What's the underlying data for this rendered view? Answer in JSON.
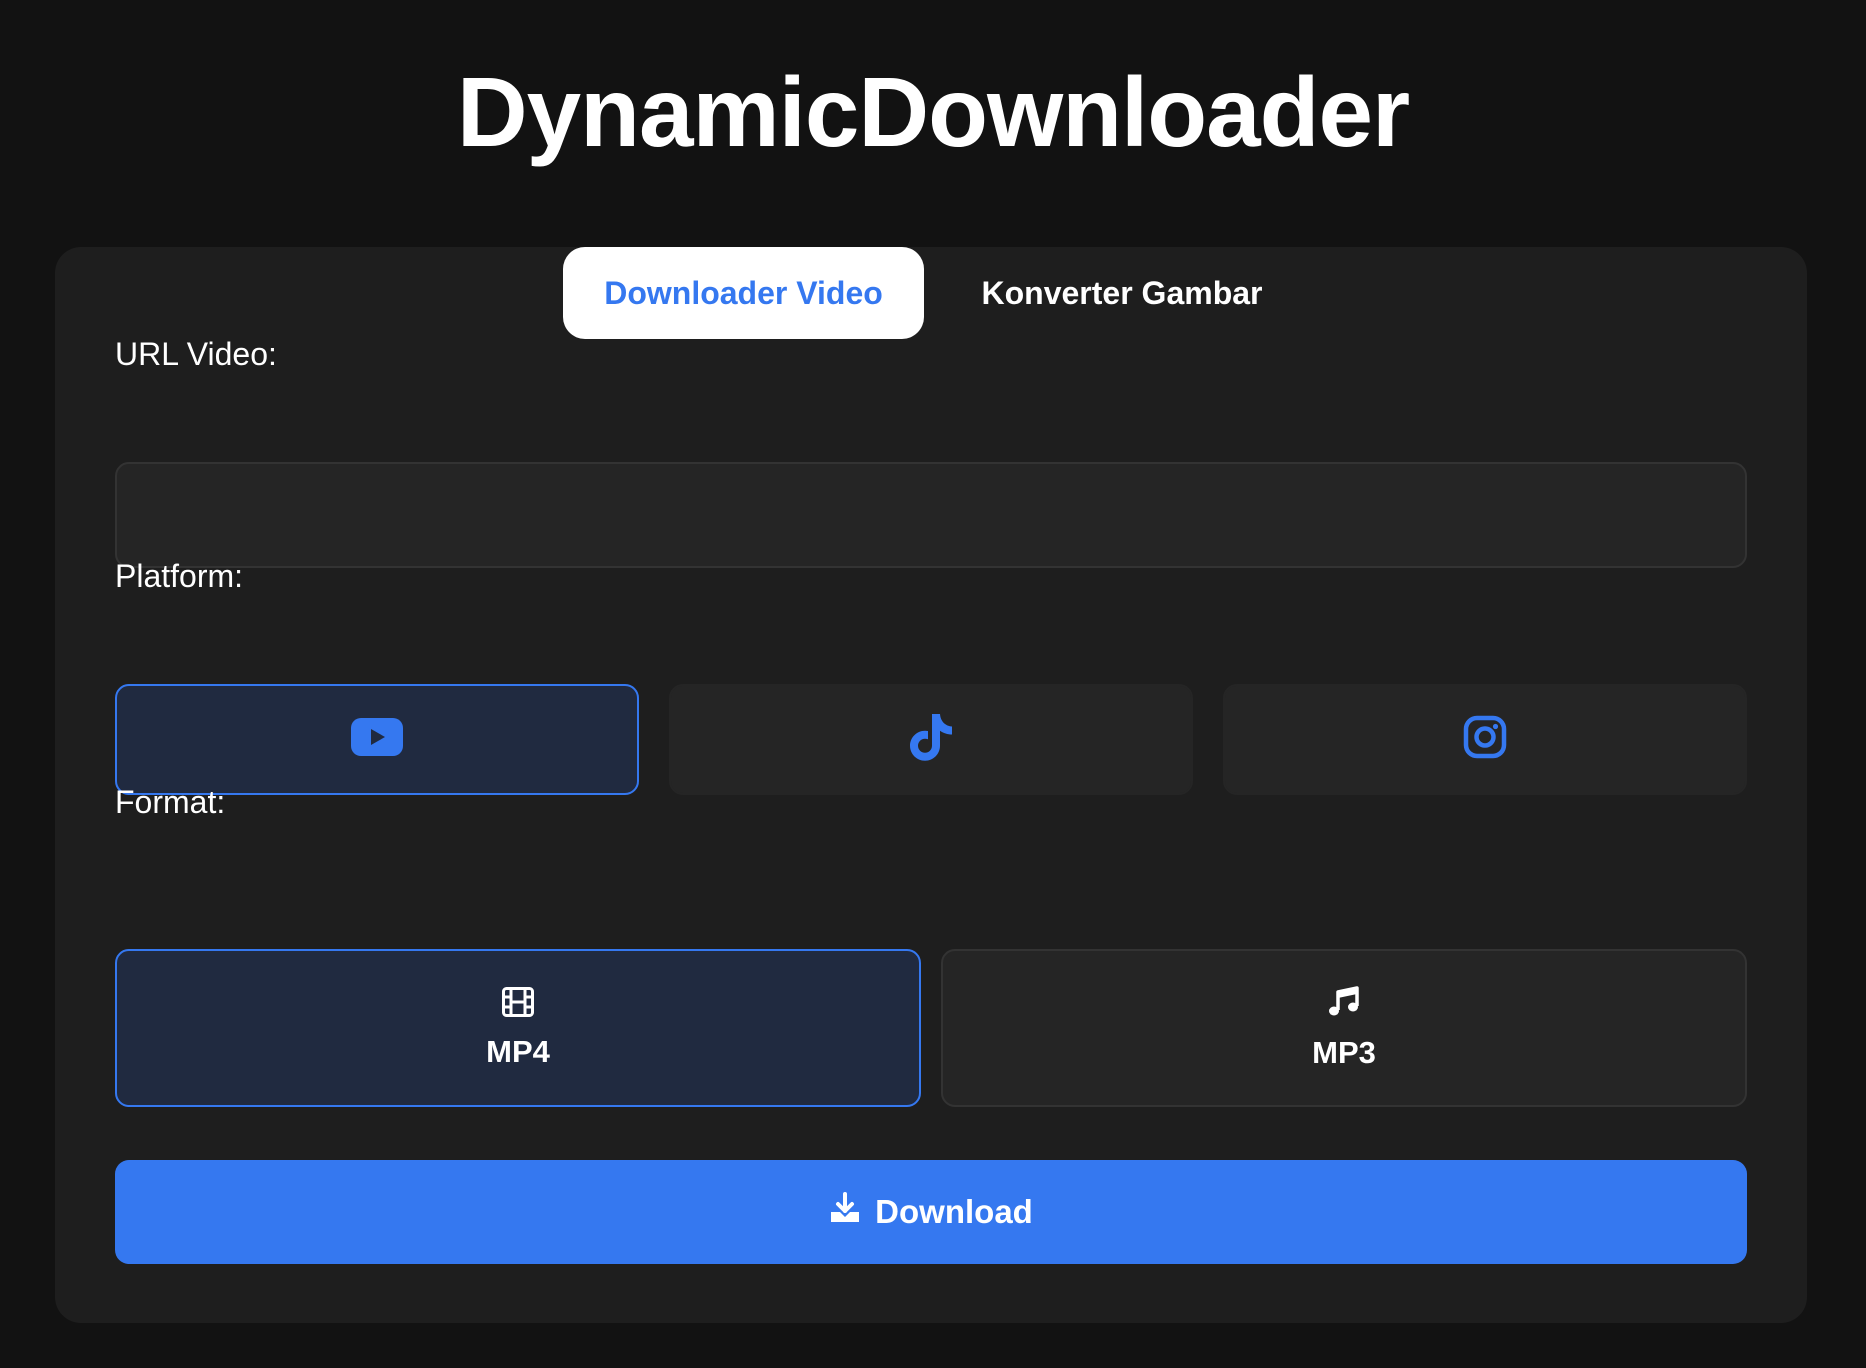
{
  "app": {
    "title": "DynamicDownloader"
  },
  "tabs": [
    {
      "label": "Downloader Video",
      "active": true
    },
    {
      "label": "Konverter Gambar",
      "active": false
    }
  ],
  "form": {
    "url_label": "URL Video:",
    "url_value": "",
    "url_placeholder": "",
    "platform_label": "Platform:",
    "platforms": [
      {
        "icon": "youtube-icon",
        "selected": true
      },
      {
        "icon": "tiktok-icon",
        "selected": false
      },
      {
        "icon": "instagram-icon",
        "selected": false
      }
    ],
    "format_label": "Format:",
    "formats": [
      {
        "label": "MP4",
        "icon": "film-icon",
        "selected": true
      },
      {
        "label": "MP3",
        "icon": "music-note-icon",
        "selected": false
      }
    ],
    "download_label": "Download"
  },
  "colors": {
    "accent": "#3578f0",
    "background": "#121212",
    "card": "#1e1e1e",
    "selected_bg": "#202a40"
  }
}
